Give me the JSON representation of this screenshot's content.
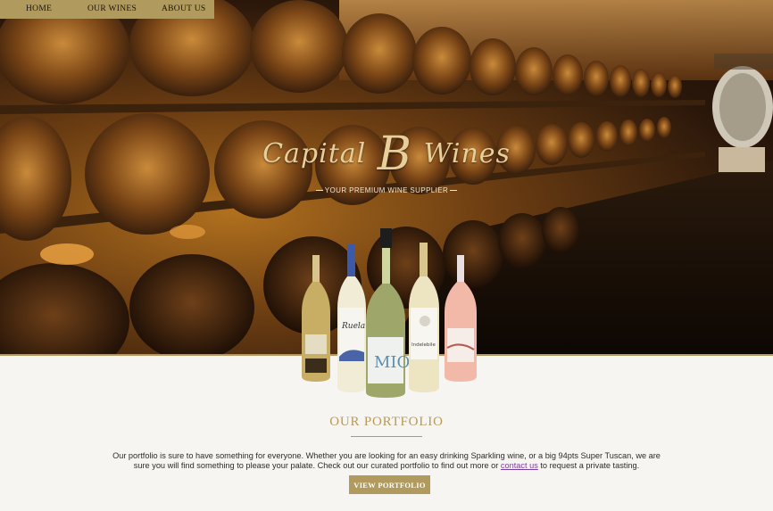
{
  "nav": {
    "items": [
      {
        "label": "HOME"
      },
      {
        "label": "OUR WINES"
      },
      {
        "label": "ABOUT US"
      }
    ]
  },
  "hero": {
    "brand_part1": "Capital",
    "brand_letter": "B",
    "brand_part2": "Wines",
    "tagline": "YOUR PREMIUM WINE SUPPLIER",
    "bottle_labels": [
      "Ruela",
      "MIO",
      "Indelebile"
    ]
  },
  "portfolio": {
    "heading": "OUR PORTFOLIO",
    "text_before_link": "Our portfolio is sure to have something for everyone. Whether you are looking for an easy drinking Sparkling wine, or a big 94pts Super Tuscan, we are sure you will find something to please your palate. Check out our curated portfolio to find out more or ",
    "link_text": "contact us",
    "text_after_link": " to request a private tasting.",
    "button_label": "VIEW PORTFOLIO"
  },
  "colors": {
    "gold": "#b19a5d",
    "heading_gold": "#b59a5c",
    "background": "#f7f5f1"
  }
}
